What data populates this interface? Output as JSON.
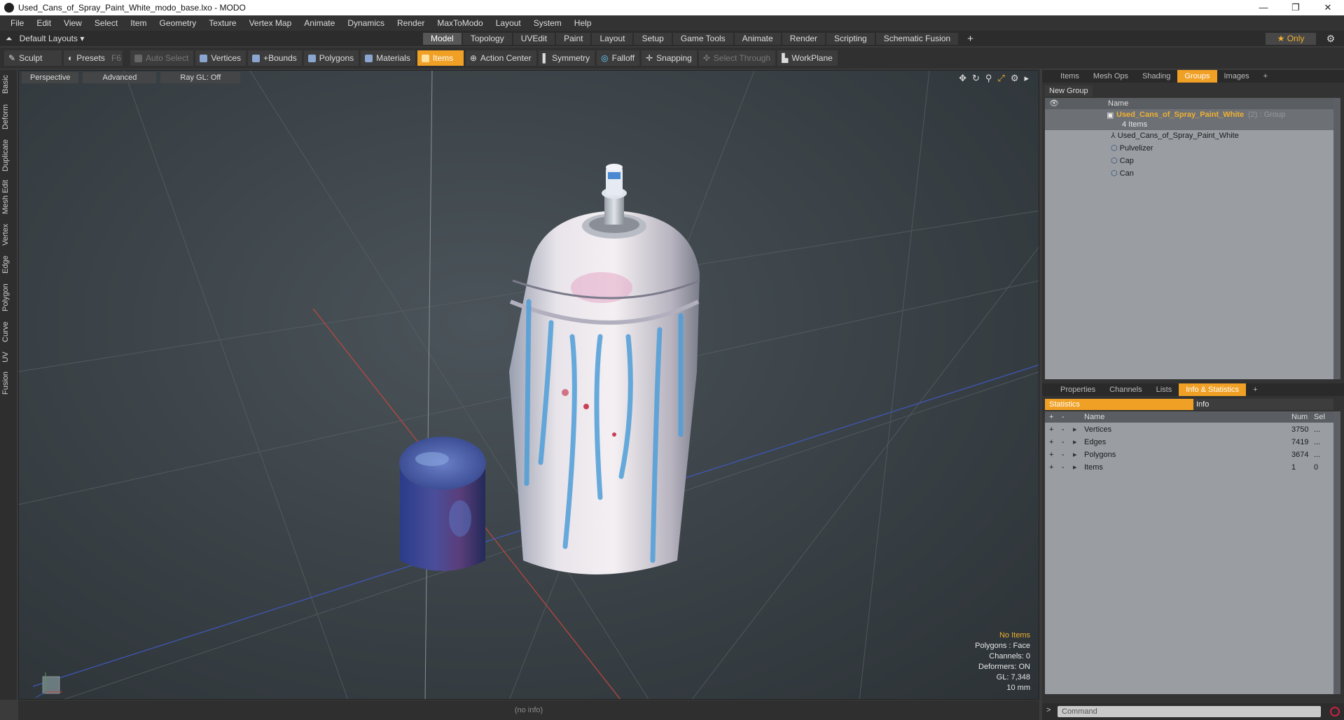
{
  "window": {
    "title": "Used_Cans_of_Spray_Paint_White_modo_base.lxo - MODO",
    "minimize": "—",
    "maximize": "❐",
    "close": "✕"
  },
  "menu": [
    "File",
    "Edit",
    "View",
    "Select",
    "Item",
    "Geometry",
    "Texture",
    "Vertex Map",
    "Animate",
    "Dynamics",
    "Render",
    "MaxToModo",
    "Layout",
    "System",
    "Help"
  ],
  "layouts": "Default Layouts ▾",
  "tabs": [
    {
      "label": "Model",
      "active": true
    },
    {
      "label": "Topology"
    },
    {
      "label": "UVEdit"
    },
    {
      "label": "Paint"
    },
    {
      "label": "Layout"
    },
    {
      "label": "Setup"
    },
    {
      "label": "Game Tools"
    },
    {
      "label": "Animate"
    },
    {
      "label": "Render"
    },
    {
      "label": "Scripting"
    },
    {
      "label": "Schematic Fusion"
    }
  ],
  "tab_add": "+",
  "only_label": "★  Only",
  "toolbar": {
    "sculpt": "Sculpt",
    "presets": "Presets",
    "presets_key": "F6",
    "auto_select": "Auto Select",
    "vertices": "Vertices",
    "bounds": "+Bounds",
    "polygons": "Polygons",
    "materials": "Materials",
    "items": "Items",
    "action_center": "Action Center",
    "symmetry": "Symmetry",
    "falloff": "Falloff",
    "snapping": "Snapping",
    "select_through": "Select Through",
    "workplane": "WorkPlane"
  },
  "left_tabs": [
    "Basic",
    "Deform",
    "Duplicate",
    "Mesh Edit",
    "Vertex",
    "Edge",
    "Polygon",
    "Curve",
    "UV",
    "Fusion"
  ],
  "viewport": {
    "view": "Perspective",
    "mode": "Advanced",
    "raygl": "Ray GL: Off",
    "info": {
      "selection": "No Items",
      "polygons": "Polygons : Face",
      "channels": "Channels: 0",
      "deformers": "Deformers: ON",
      "gl": "GL: 7,348",
      "unit": "10 mm"
    }
  },
  "status": "(no info)",
  "groups_panel": {
    "tabs": [
      {
        "label": "Items"
      },
      {
        "label": "Mesh Ops"
      },
      {
        "label": "Shading"
      },
      {
        "label": "Groups",
        "active": true
      },
      {
        "label": "Images"
      }
    ],
    "new_group": "New Group",
    "name_header": "Name",
    "group_name": "Used_Cans_of_Spray_Paint_White",
    "group_suffix": "(2) : Group",
    "group_count": "4 Items",
    "children": [
      "Used_Cans_of_Spray_Paint_White",
      "Pulvelizer",
      "Cap",
      "Can"
    ]
  },
  "stats_panel": {
    "tabs": [
      {
        "label": "Properties"
      },
      {
        "label": "Channels"
      },
      {
        "label": "Lists"
      },
      {
        "label": "Info & Statistics",
        "active": true
      }
    ],
    "statistics": "Statistics",
    "info": "Info",
    "headers": {
      "name": "Name",
      "num": "Num",
      "sel": "Sel"
    },
    "rows": [
      {
        "name": "Vertices",
        "num": "3750",
        "sel": "..."
      },
      {
        "name": "Edges",
        "num": "7419",
        "sel": "..."
      },
      {
        "name": "Polygons",
        "num": "3674",
        "sel": "..."
      },
      {
        "name": "Items",
        "num": "1",
        "sel": "0"
      }
    ]
  },
  "command_placeholder": "Command",
  "command_prompt": ">"
}
